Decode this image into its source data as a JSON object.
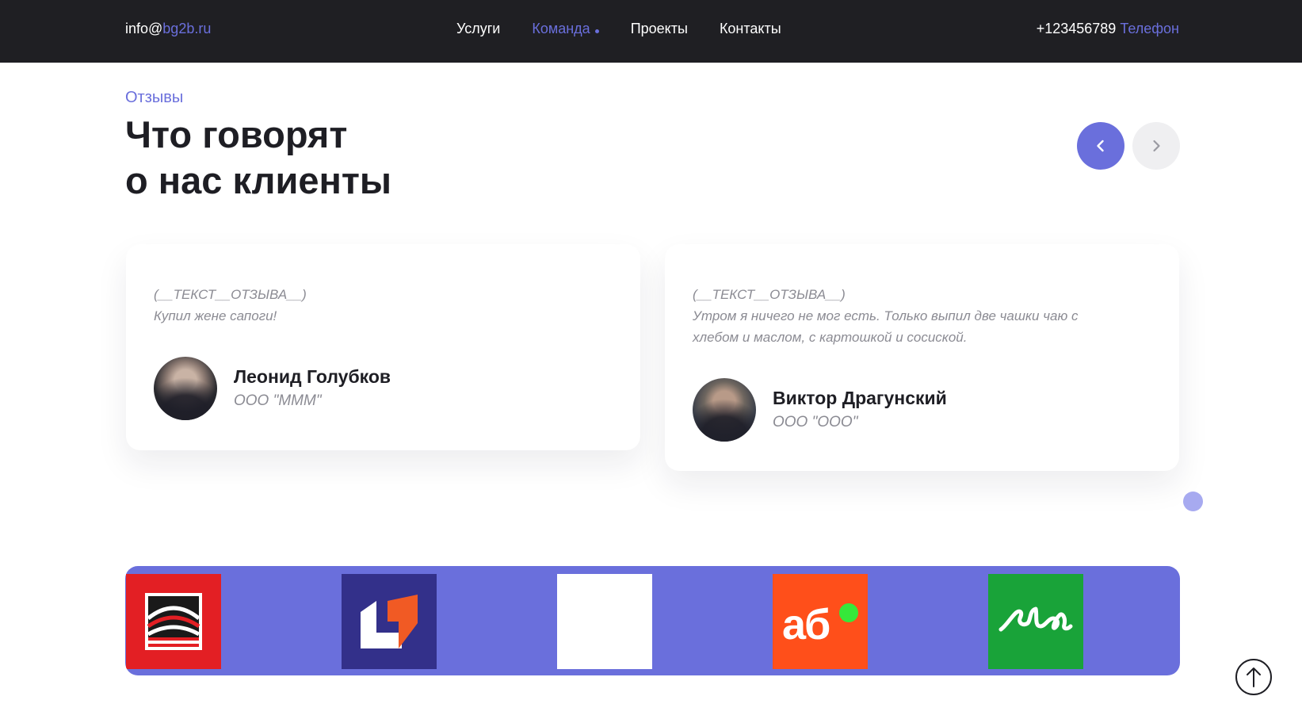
{
  "header": {
    "email_user": "info@",
    "email_domain": "bg2b.ru",
    "nav": [
      {
        "label": "Услуги"
      },
      {
        "label": "Команда"
      },
      {
        "label": "Проекты"
      },
      {
        "label": "Контакты"
      }
    ],
    "active_nav": "Команда",
    "phone_number": "+123456789",
    "phone_label": "Телефон"
  },
  "section": {
    "eyebrow": "Отзывы",
    "title_line1": "Что говорят",
    "title_line2": "о нас клиенты"
  },
  "reviews": [
    {
      "placeholder": "(__ТЕКСТ__ОТЗЫВА__)",
      "text": "Купил жене сапоги!",
      "name": "Леонид Голубков",
      "company": "ООО \"МММ\""
    },
    {
      "placeholder": "(__ТЕКСТ__ОТЗЫВА__)",
      "text": "Утром я ничего не мог есть. Только выпил две чашки чаю с хлебом и маслом, с картошкой и сосиской.",
      "name": "Виктор Драгунский",
      "company": "ООО \"ООО\""
    }
  ],
  "logos": {
    "ab_text": "аб"
  },
  "colors": {
    "accent": "#6a6fdc",
    "header_bg": "#1f1f23",
    "logo_red": "#e31f24",
    "logo_navy": "#33308a",
    "logo_orange": "#ff4f1a",
    "logo_green": "#19a339"
  },
  "icons": {
    "prev": "chevron-left-icon",
    "next": "chevron-right-icon",
    "scroll_top": "arrow-up-icon"
  }
}
